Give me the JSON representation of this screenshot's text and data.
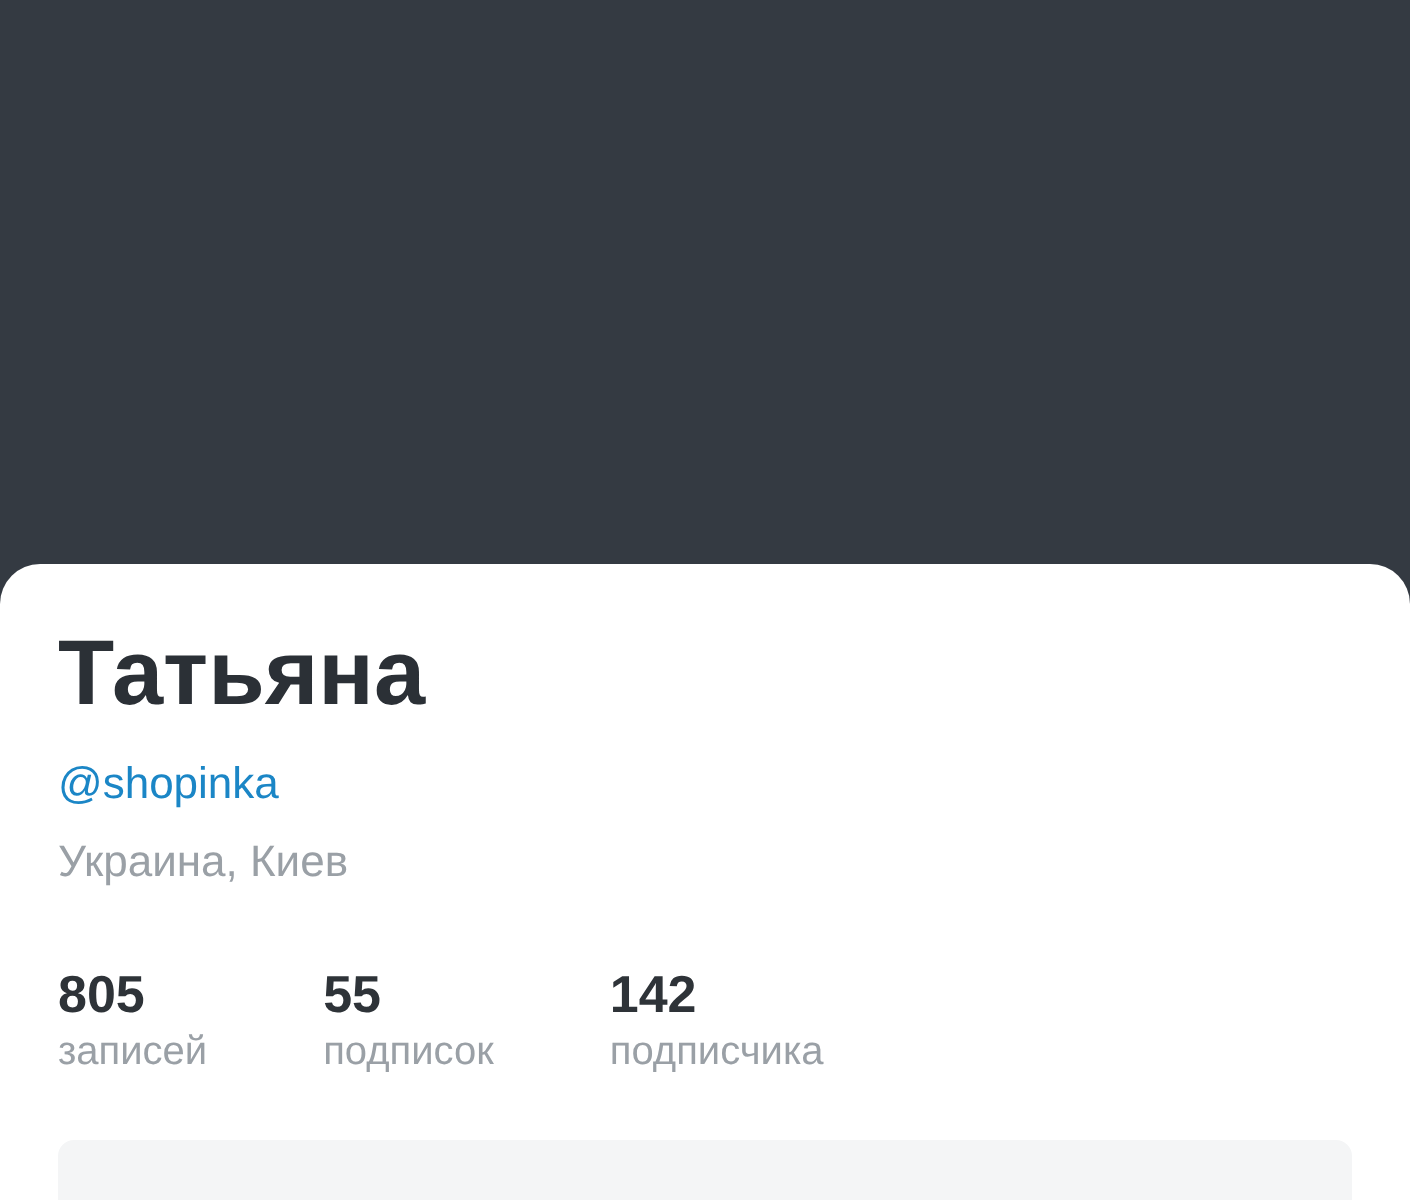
{
  "profile": {
    "name": "Татьяна",
    "handle": "@shopinka",
    "location": "Украина, Киев"
  },
  "stats": [
    {
      "value": "805",
      "label": "записей"
    },
    {
      "value": "55",
      "label": "подписок"
    },
    {
      "value": "142",
      "label": "подписчика"
    }
  ]
}
